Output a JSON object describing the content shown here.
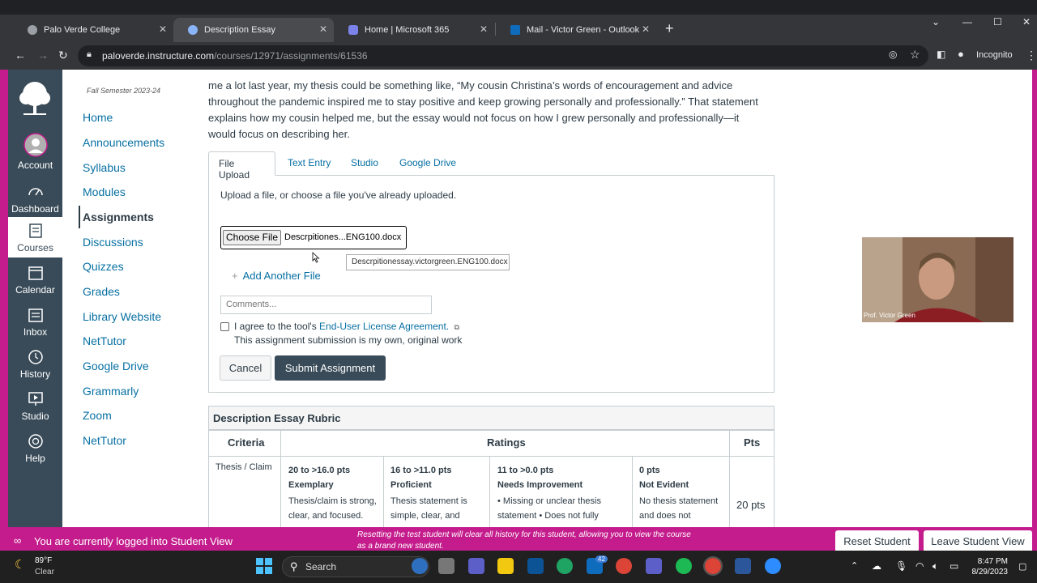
{
  "browser": {
    "tabs": [
      {
        "title": "Palo Verde College"
      },
      {
        "title": "Description Essay"
      },
      {
        "title": "Home | Microsoft 365"
      },
      {
        "title": "Mail - Victor Green - Outlook"
      }
    ],
    "new_tab": "+",
    "url_domain": "paloverde.instructure.com",
    "url_path": "/courses/12971/assignments/61536",
    "incognito": "Incognito"
  },
  "global_nav": {
    "items": [
      {
        "label": "Account"
      },
      {
        "label": "Dashboard"
      },
      {
        "label": "Courses"
      },
      {
        "label": "Calendar"
      },
      {
        "label": "Inbox"
      },
      {
        "label": "History"
      },
      {
        "label": "Studio"
      },
      {
        "label": "Help"
      }
    ]
  },
  "course_nav": {
    "term": "Fall Semester 2023-24",
    "items": [
      {
        "label": "Home"
      },
      {
        "label": "Announcements"
      },
      {
        "label": "Syllabus"
      },
      {
        "label": "Modules"
      },
      {
        "label": "Assignments"
      },
      {
        "label": "Discussions"
      },
      {
        "label": "Quizzes"
      },
      {
        "label": "Grades"
      },
      {
        "label": "Library Website"
      },
      {
        "label": "NetTutor"
      },
      {
        "label": "Google Drive"
      },
      {
        "label": "Grammarly"
      },
      {
        "label": "Zoom"
      },
      {
        "label": "NetTutor"
      }
    ]
  },
  "content": {
    "para_line1": "me a lot last year, my thesis could be something like, “My cousin Christina’s words of encouragement and advice",
    "para_line2": "throughout the pandemic inspired me to stay positive and keep growing personally and professionally.” That statement",
    "para_line3": "explains how my cousin helped me, but the essay would not focus on how I grew personally and professionally—it",
    "para_line4": "would focus on describing her."
  },
  "submission": {
    "tabs": [
      "File Upload",
      "Text Entry",
      "Studio",
      "Google Drive"
    ],
    "hint": "Upload a file, or choose a file you've already uploaded.",
    "choose_file": "Choose File",
    "file_name": "Descrpitiones...ENG100.docx",
    "tooltip": "Descrpitionessay.victorgreen.ENG100.docx",
    "add_another": "Add Another File",
    "comments_placeholder": "Comments...",
    "agree_prefix": "I agree to the tool's ",
    "agree_link": "End-User License Agreement.",
    "agree_line2": "This assignment submission is my own, original work",
    "cancel": "Cancel",
    "submit": "Submit Assignment"
  },
  "rubric": {
    "title": "Description Essay Rubric",
    "headers": {
      "criteria": "Criteria",
      "ratings": "Ratings",
      "pts": "Pts"
    },
    "criterion": "Thesis / Claim",
    "ratings": [
      {
        "range": "20 to >16.0 pts",
        "name": "Exemplary",
        "desc1": "Thesis/claim is strong,",
        "desc2": "clear, and focused."
      },
      {
        "range": "16 to >11.0 pts",
        "name": "Proficient",
        "desc1": "Thesis statement is",
        "desc2": "simple, clear, and"
      },
      {
        "range": "11 to >0.0 pts",
        "name": "Needs Improvement",
        "desc1": "• Missing or unclear thesis",
        "desc2": "statement • Does not fully"
      },
      {
        "range": "0 pts",
        "name": "Not Evident",
        "desc1": "No thesis statement",
        "desc2": "and does not"
      }
    ],
    "points": "20 pts"
  },
  "video": {
    "name": "Prof. Victor Green"
  },
  "student_view": {
    "message": "You are currently logged into Student View",
    "note": "Resetting the test student will clear all history for this student, allowing you to view the course as a brand new student.",
    "reset": "Reset Student",
    "leave": "Leave Student View"
  },
  "taskbar": {
    "weather_temp": "89°F",
    "weather_cond": "Clear",
    "search": "Search",
    "badge": "42",
    "time": "8:47 PM",
    "date": "8/29/2023"
  },
  "colors": {
    "canvas_nav": "#394b58",
    "link": "#0770a3",
    "student_view_bar": "#c41c8c"
  }
}
